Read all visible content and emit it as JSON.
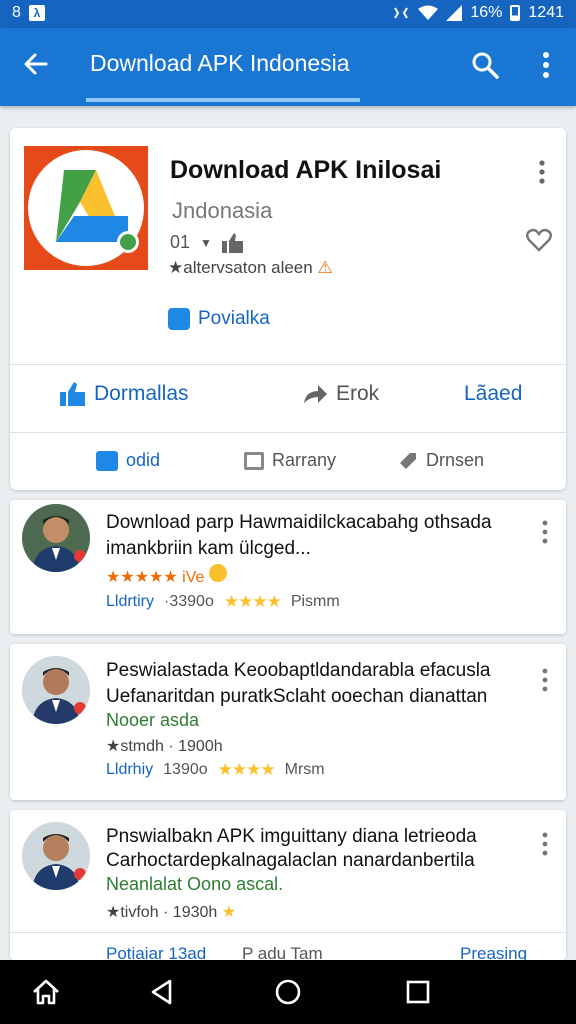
{
  "status_bar": {
    "left_number": "8",
    "left_icon": "accessibility-icon",
    "battery_percent": "16%",
    "time": "1241"
  },
  "app_bar": {
    "title": "Download APK Indonesia"
  },
  "app": {
    "name": "Download APK Inilosai",
    "subtitle": "Jndonasia",
    "meta": "01",
    "rating_text": "★altervsaton aleen",
    "badge_label": "Povialka"
  },
  "actions": {
    "download_label": "Dormallas",
    "share_label": "Erok",
    "load_label": "Lãaed"
  },
  "tabs": {
    "tab1": "odid",
    "tab2": "Rarrany",
    "tab3": "Drnsen"
  },
  "reviews": [
    {
      "title_line1": "Download parp Hawmaidilckacabahg othsada",
      "title_line2": "imankbriin kam ülcged...",
      "rating_text": "★★★★★ iVe",
      "stats_label": "Lldrtiry",
      "stats_value": "·3390o",
      "stars": "★★★★",
      "stats_suffix": "Pismm"
    },
    {
      "title_line1": "Peswialastada Keoobaptldandarabla efacusla",
      "title_line2": "Uefanaritdan puratkSclaht ooechan dianattan",
      "green_text": "Nooer asda",
      "rating_text": "★stmdh · 1900h",
      "stats_label": "Lldrhiy",
      "stats_value": "1390o",
      "stars": "★★★★",
      "stats_suffix": "Mrsm"
    },
    {
      "title_line1": "Pnswialbakn APK imguittany diana letrieoda",
      "title_line2": "Carhoctardepkalnagalaclan nanardanbertila",
      "green_text": "Neanlalat Oono ascal.",
      "rating_text": "★tivfoh · 1930h"
    }
  ],
  "partial_row": {
    "left": "Potiaiar 13ad",
    "middle": "P adu Tam",
    "right": "Preasing"
  },
  "colors": {
    "primary": "#1976d2",
    "status": "#1565c0",
    "star": "#fbc02d",
    "green": "#2e7d32"
  }
}
